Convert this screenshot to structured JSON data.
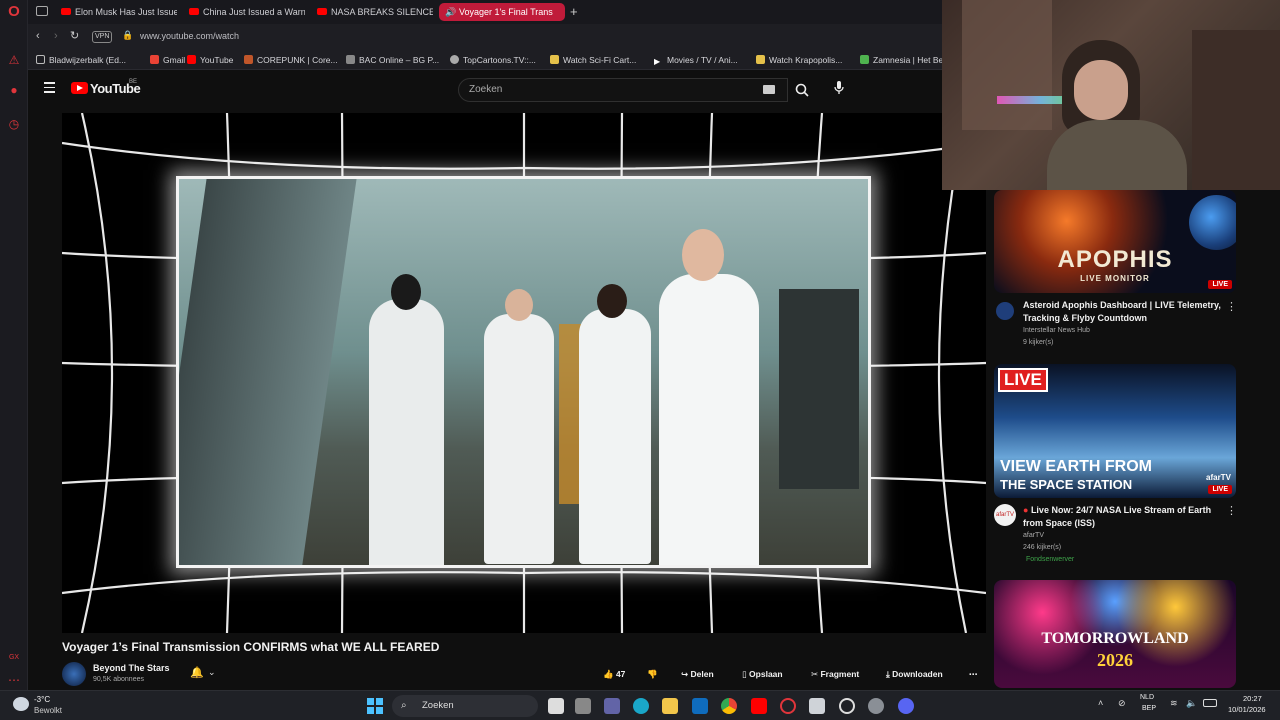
{
  "browser": {
    "tabs": [
      {
        "label": "Elon Musk Has Just Issue"
      },
      {
        "label": "China Just Issued a Warni"
      },
      {
        "label": "NASA BREAKS SILENCE o"
      },
      {
        "label": "Voyager 1's Final Trans"
      }
    ],
    "address": "www.youtube.com/watch",
    "vpn": "VPN",
    "bookmarks": [
      "Bladwijzerbalk (Ed...",
      "Gmail",
      "YouTube",
      "COREPUNK | Core...",
      "BAC Online – BG P...",
      "TopCartoons.TV::...",
      "Watch Sci-Fi Cart...",
      "Movies / TV / Ani...",
      "Watch Krapopolis...",
      "Zamnesia | Het Be"
    ]
  },
  "youtube": {
    "logo": "YouTube",
    "region": "BE",
    "search_placeholder": "Zoeken"
  },
  "video": {
    "title": "Voyager 1’s Final Transmission CONFIRMS what WE ALL FEARED",
    "channel": "Beyond The Stars",
    "subscribers": "90,5K abonnees",
    "likes": "47",
    "actions": {
      "share": "Delen",
      "save": "Opslaan",
      "clip": "Fragment",
      "download": "Downloaden"
    }
  },
  "recommendations": [
    {
      "thumb_text": "APOPHIS",
      "thumb_sub": "LIVE MONITOR",
      "title": "Asteroid Apophis Dashboard | LIVE Telemetry, Tracking & Flyby Countdown",
      "channel": "Interstellar News Hub",
      "meta": "9 kijker(s)",
      "live": "LIVE"
    },
    {
      "thumb_live": "LIVE",
      "thumb_text": "VIEW EARTH FROM",
      "thumb_text2": "THE SPACE STATION",
      "thumb_brand": "afarTV",
      "title": "Live Now: 24/7 NASA Live Stream of Earth from Space (ISS)",
      "channel": "afarTV",
      "meta": "246 kijker(s)",
      "tag": "Fondsenwerver",
      "live": "LIVE"
    },
    {
      "thumb_text": "TOMORROWLAND",
      "thumb_sub": "2026"
    }
  ],
  "taskbar": {
    "weather_temp": "-3°C",
    "weather_desc": "Bewolkt",
    "search": "Zoeken",
    "lang1": "NLD",
    "lang2": "BEP",
    "time": "20:27",
    "date": "10/01/2026"
  },
  "colors": {
    "accent": "#c01b3a",
    "yt_red": "#ff0000",
    "live_red": "#cc0000"
  }
}
